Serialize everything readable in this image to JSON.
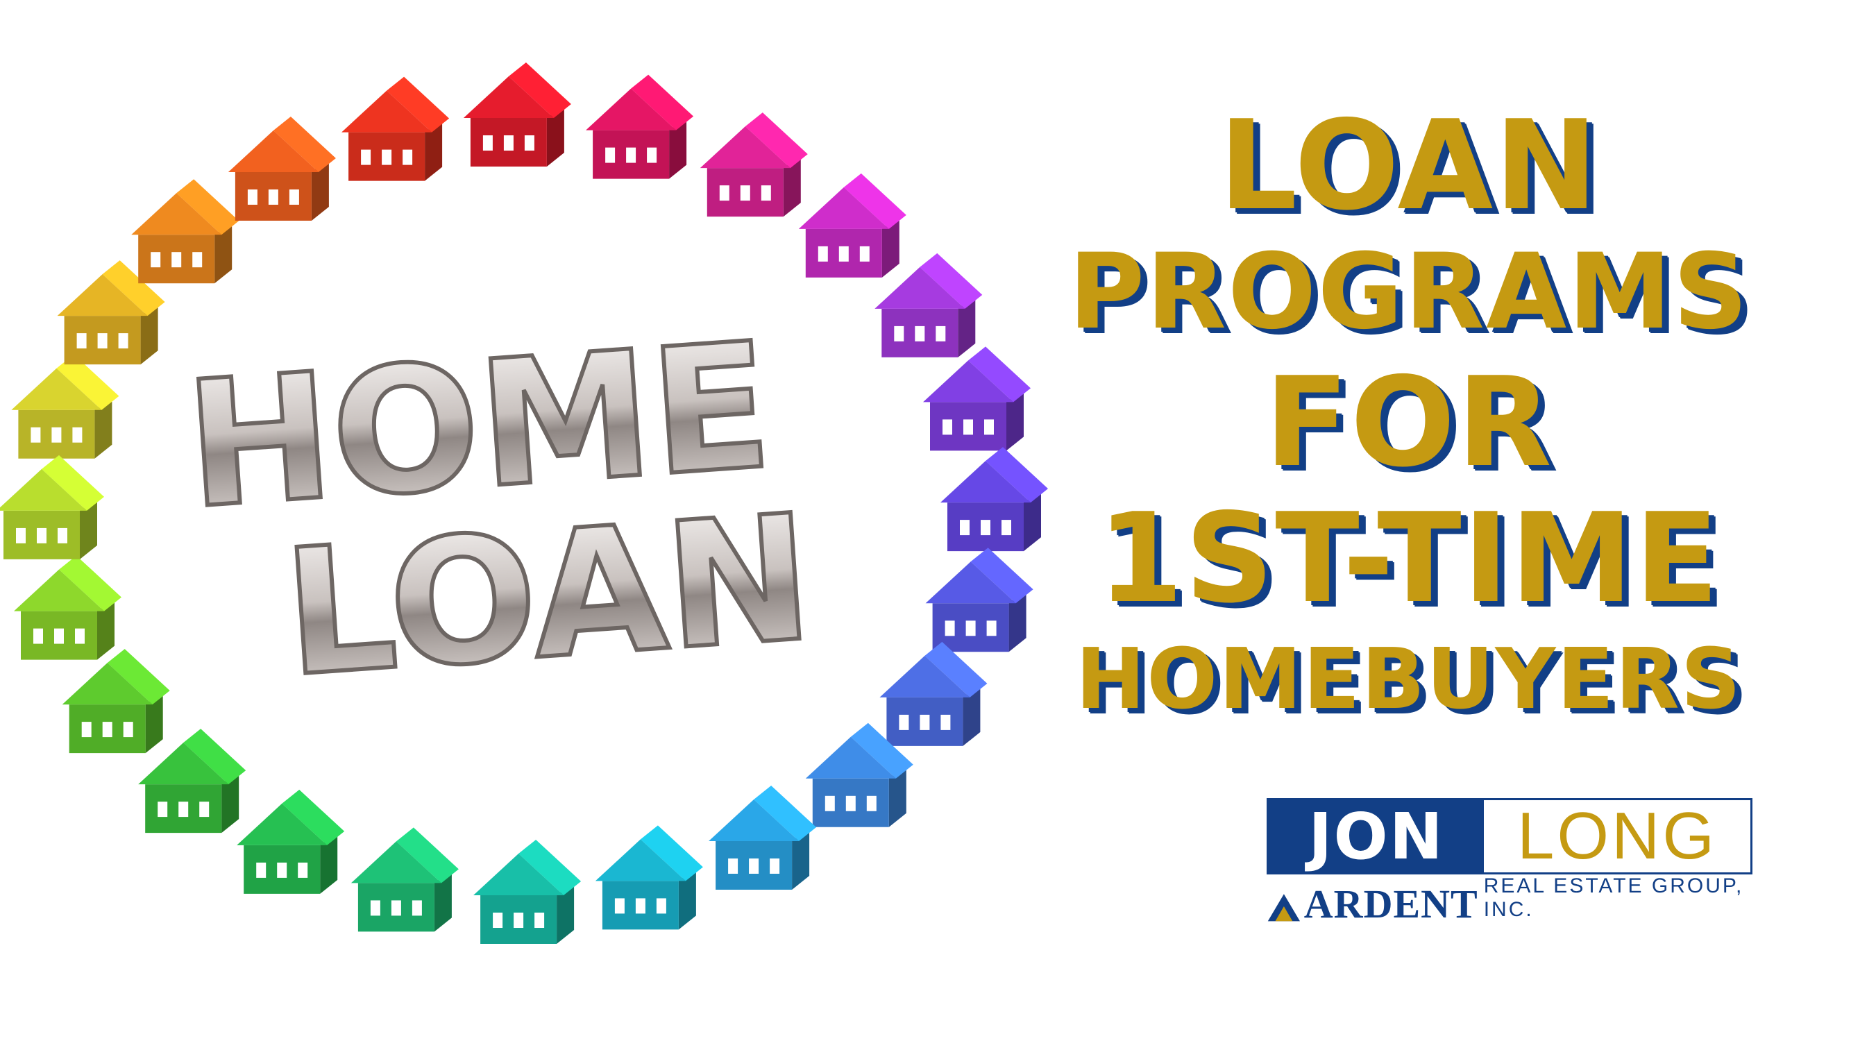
{
  "art": {
    "line1": "HOME",
    "line2": "LOAN",
    "house_colors": [
      "#d9d42f",
      "#e6b525",
      "#ef8a1f",
      "#f2611f",
      "#ee3420",
      "#e61c2d",
      "#e51665",
      "#e12398",
      "#cf2dcb",
      "#a63be0",
      "#8140e4",
      "#6648e6",
      "#575ae6",
      "#4e6fe6",
      "#3f8de8",
      "#2aa7e8",
      "#1ab7d2",
      "#18bfa8",
      "#1ec277",
      "#26c052",
      "#38c23d",
      "#5ecb2e",
      "#8ed82c",
      "#b9de2e"
    ]
  },
  "headline": {
    "line1": "LOAN",
    "line2": "PROGRAMS",
    "line3": "FOR",
    "line4": "1ST-TIME",
    "line5": "HOMEBUYERS"
  },
  "logo": {
    "first": "JON",
    "last": "LONG",
    "company": "ARDENT",
    "company_sub": "REAL ESTATE GROUP, INC."
  },
  "colors": {
    "gold": "#c59a12",
    "navy": "#123f86",
    "silver": "#d8d3d0"
  }
}
